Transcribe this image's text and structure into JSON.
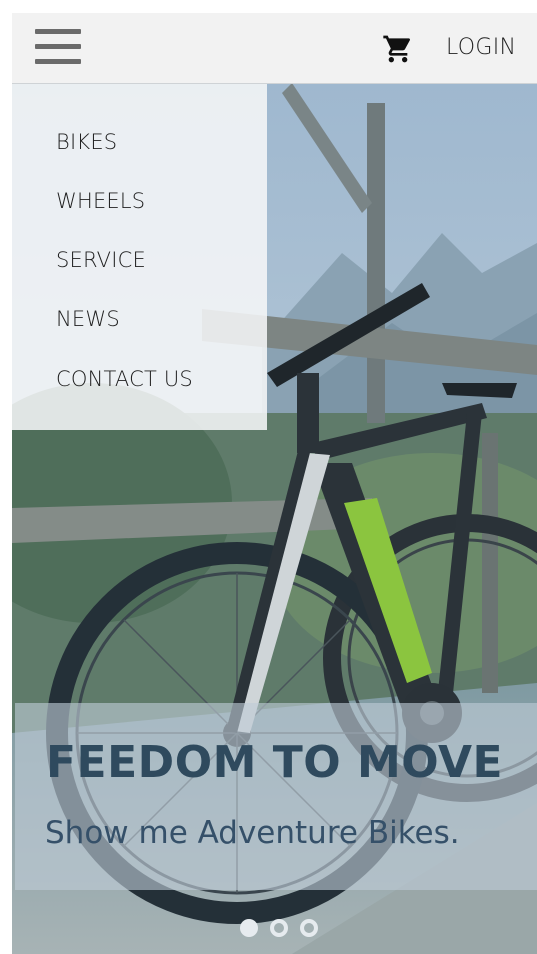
{
  "header": {
    "menu_icon": "hamburger-menu-icon",
    "cart_icon": "shopping-cart-icon",
    "login_label": "LOGIN"
  },
  "nav_menu": {
    "items": [
      {
        "label": "BIKES"
      },
      {
        "label": "WHEELS"
      },
      {
        "label": "SERVICE"
      },
      {
        "label": "NEWS"
      },
      {
        "label": "CONTACT US"
      }
    ]
  },
  "hero": {
    "image": "mountain-bike-photo",
    "title": "FEEDOM TO MOVE",
    "subtitle": "Show me Adventure Bikes."
  },
  "carousel": {
    "slide_count": 3,
    "active_index": 0
  },
  "colors": {
    "header_bg": "#f2f2f2",
    "banner_text": "#2f4a5e",
    "bike_accent": "#8bc53f"
  }
}
